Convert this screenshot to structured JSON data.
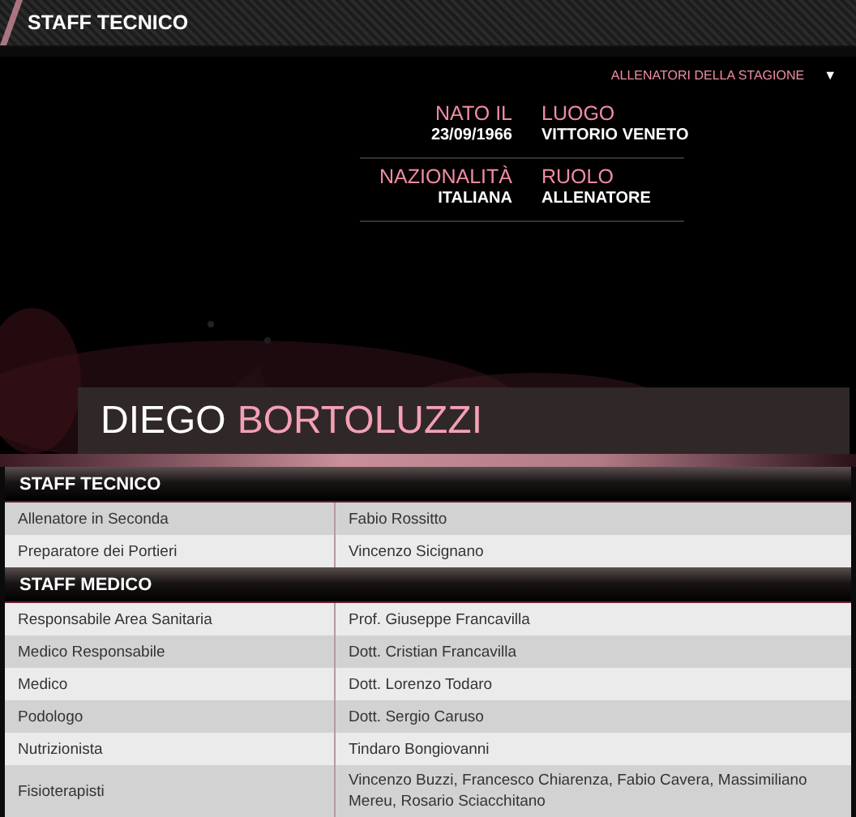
{
  "header": {
    "title": "STAFF TECNICO"
  },
  "season_menu": {
    "label": "ALLENATORI DELLA STAGIONE",
    "caret": "▼"
  },
  "profile": {
    "first_name": "DIEGO",
    "last_name": "BORTOLUZZI",
    "facts": [
      {
        "label": "NATO IL",
        "value": "23/09/1966",
        "label_2": "LUOGO",
        "value_2": "VITTORIO VENETO"
      },
      {
        "label": "NAZIONALITÀ",
        "value": "ITALIANA",
        "label_2": "RUOLO",
        "value_2": "ALLENATORE"
      }
    ]
  },
  "sections": [
    {
      "title": "STAFF TECNICO",
      "rows": [
        {
          "role": "Allenatore in Seconda",
          "name": "Fabio Rossitto"
        },
        {
          "role": "Preparatore dei Portieri",
          "name": "Vincenzo Sicignano"
        }
      ]
    },
    {
      "title": "STAFF MEDICO",
      "rows": [
        {
          "role": "Responsabile Area Sanitaria",
          "name": "Prof. Giuseppe Francavilla"
        },
        {
          "role": "Medico Responsabile",
          "name": "Dott. Cristian Francavilla"
        },
        {
          "role": "Medico",
          "name": "Dott. Lorenzo Todaro"
        },
        {
          "role": "Podologo",
          "name": "Dott. Sergio Caruso"
        },
        {
          "role": "Nutrizionista",
          "name": "Tindaro Bongiovanni"
        },
        {
          "role": "Fisioterapisti",
          "name": "Vincenzo Buzzi, Francesco Chiarenza, Fabio Cavera, Massimiliano Mereu, Rosario Sciacchitano"
        }
      ]
    }
  ]
}
